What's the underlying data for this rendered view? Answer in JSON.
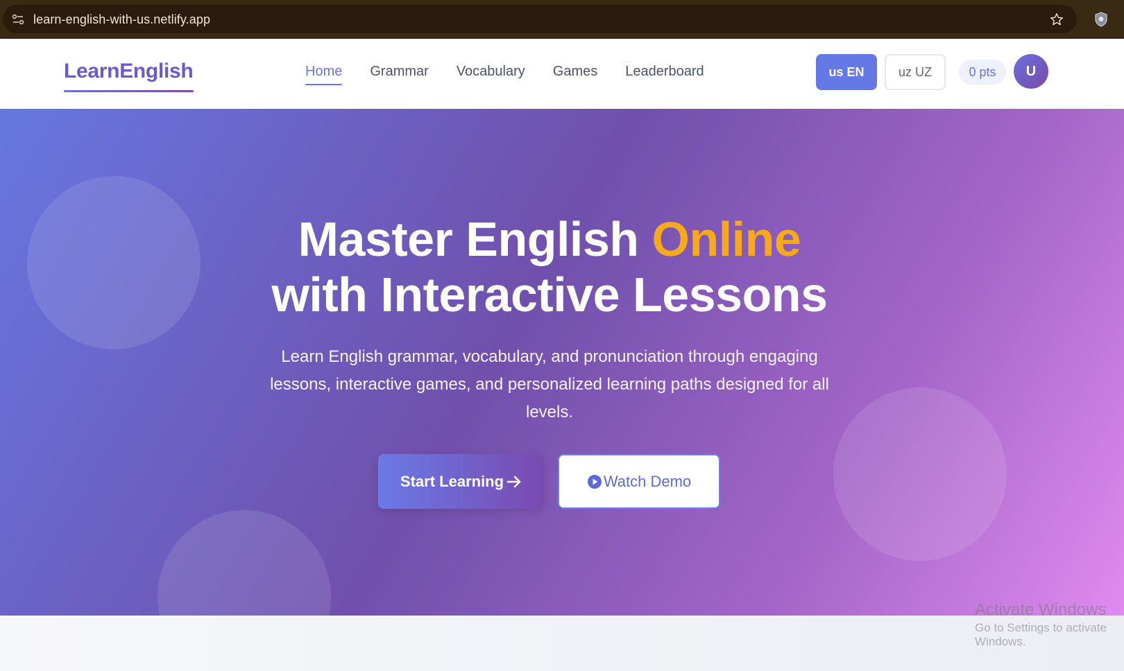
{
  "browser": {
    "url": "learn-english-with-us.netlify.app"
  },
  "header": {
    "logo": "LearnEnglish",
    "nav": [
      {
        "label": "Home",
        "active": true
      },
      {
        "label": "Grammar",
        "active": false
      },
      {
        "label": "Vocabulary",
        "active": false
      },
      {
        "label": "Games",
        "active": false
      },
      {
        "label": "Leaderboard",
        "active": false
      }
    ],
    "lang_en": "us EN",
    "lang_uz": "uz UZ",
    "points": "0 pts",
    "avatar_initial": "U"
  },
  "hero": {
    "title_part1": "Master English",
    "title_accent": "Online",
    "title_part2": "with Interactive Lessons",
    "subtitle": "Learn English grammar, vocabulary, and pronunciation through engaging lessons, interactive games, and personalized learning paths designed for all levels.",
    "primary_button": "Start Learning",
    "secondary_button": "Watch Demo"
  },
  "watermark": {
    "title": "Activate Windows",
    "subtitle": "Go to Settings to activate Windows."
  },
  "colors": {
    "accent": "#f7a91e",
    "brand": "#6a74e0",
    "hero_start": "#6677e0",
    "hero_end": "#e08aee"
  }
}
